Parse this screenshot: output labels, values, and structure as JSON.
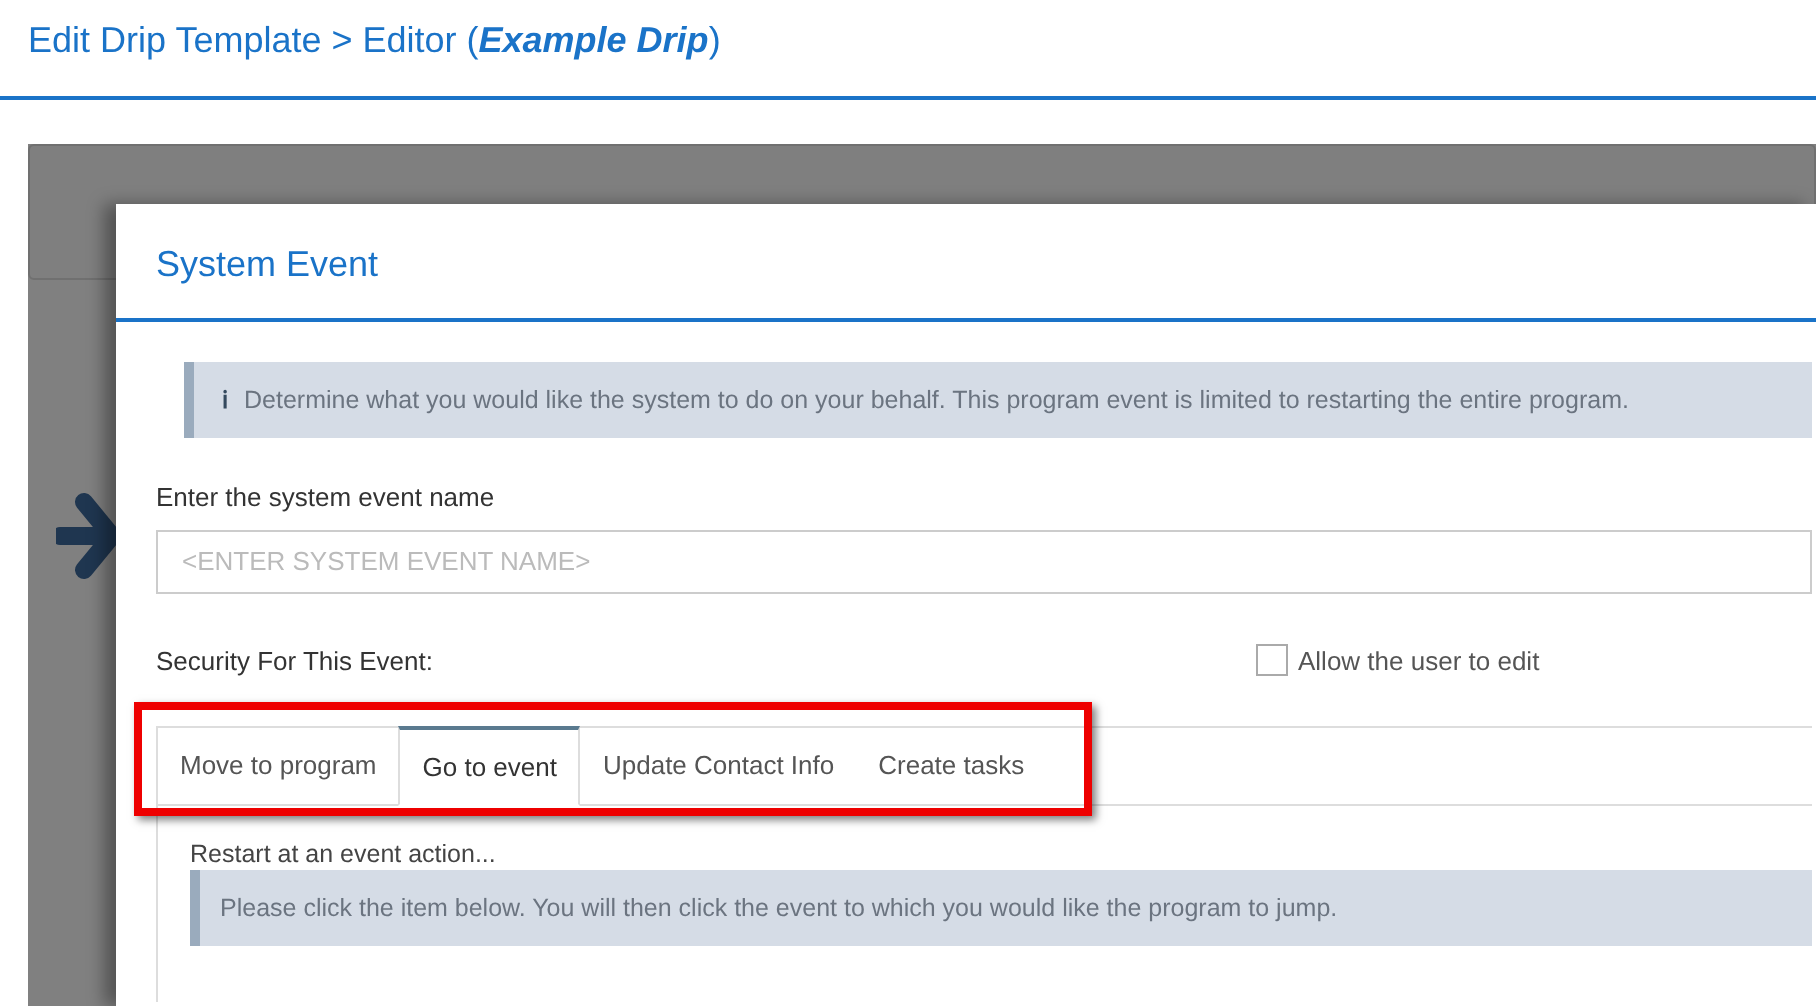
{
  "page": {
    "breadcrumb": "Edit Drip Template > Editor (",
    "breadcrumb_name": "Example Drip",
    "breadcrumb_end": ")"
  },
  "dialog": {
    "title": "System Event",
    "info": "Determine what you would like the system to do on your behalf. This program event is limited to restarting the entire program.",
    "info_icon": "ℹ",
    "name_label": "Enter the system event name",
    "name_field": {
      "placeholder": "<ENTER SYSTEM EVENT NAME>"
    },
    "security_label": "Security For This Event:",
    "allow_edit": {
      "label": "Allow the user to edit",
      "checked": false
    },
    "tabs": [
      {
        "label": "Move to program",
        "selected": false
      },
      {
        "label": "Go to event",
        "selected": true
      },
      {
        "label": "Update Contact Info",
        "selected": false
      },
      {
        "label": "Create tasks",
        "selected": false
      }
    ],
    "pane": {
      "caption": "Restart at an event action...",
      "info": "Please click the item below. You will then click the event to which you would like the program to jump."
    }
  }
}
